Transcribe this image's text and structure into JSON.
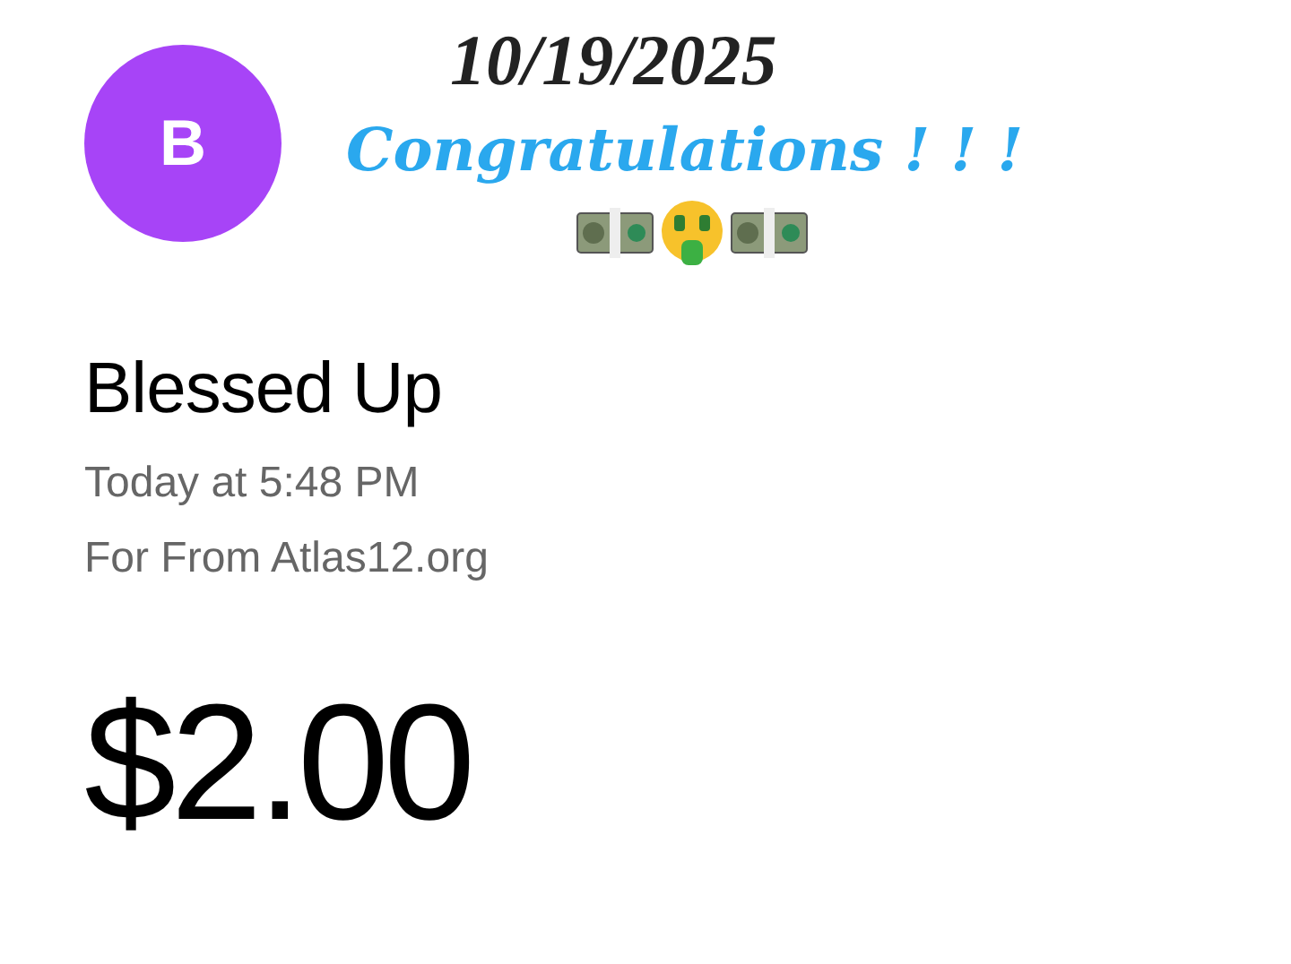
{
  "overlay": {
    "date": "10/19/2025",
    "greeting": "Congratulations ! ! !"
  },
  "avatar": {
    "initial": "B",
    "color": "#a744f7"
  },
  "payment": {
    "name": "Blessed Up",
    "time": "Today at 5:48 PM",
    "note": "For From Atlas12.org",
    "amount": "$2.00"
  }
}
